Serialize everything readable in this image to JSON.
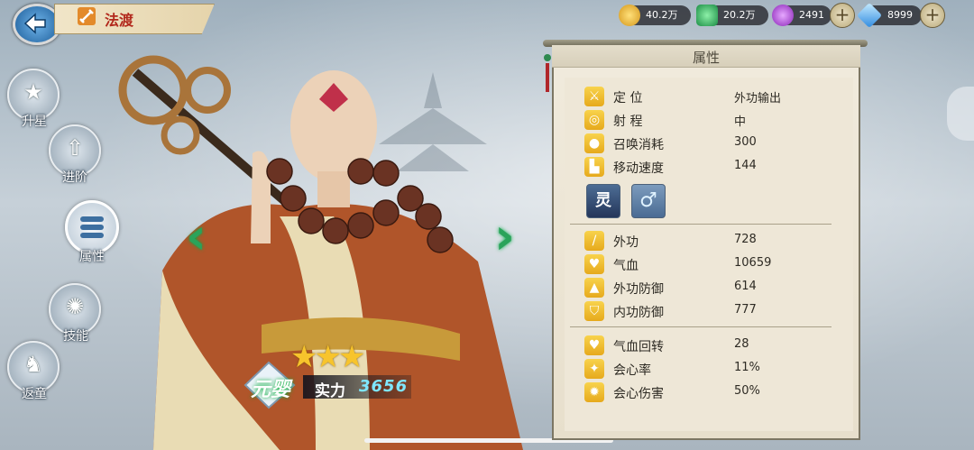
{
  "header": {
    "back_label": "",
    "hero_name": "法渡"
  },
  "resources": [
    {
      "name": "gold",
      "value": "40.2万",
      "icon": "gold-coin-icon",
      "color": "#f1c23a"
    },
    {
      "name": "jade",
      "value": "20.2万",
      "icon": "green-gem-icon",
      "color": "#3fbf6a"
    },
    {
      "name": "spirit",
      "value": "2491",
      "icon": "purple-swirl-icon",
      "color": "#b04ad8"
    },
    {
      "name": "diamond",
      "value": "8999",
      "icon": "diamond-icon",
      "color": "#5fb8ff"
    }
  ],
  "menu": [
    {
      "id": "star-up",
      "label": "升星",
      "icon": "stars-icon"
    },
    {
      "id": "advance",
      "label": "进阶",
      "icon": "arrow-up-icon"
    },
    {
      "id": "attributes",
      "label": "属性",
      "icon": "list-icon",
      "active": true
    },
    {
      "id": "skills",
      "label": "技能",
      "icon": "skill-sun-icon"
    },
    {
      "id": "rebirth",
      "label": "返童",
      "icon": "rocking-horse-icon"
    }
  ],
  "hero": {
    "stars": 3,
    "rank": "元婴",
    "power_label": "实力",
    "power_value": "3656"
  },
  "panel": {
    "title": "属性",
    "basic": [
      {
        "label": "定 位",
        "value": "外功输出",
        "icon": "sword-icon"
      },
      {
        "label": "射 程",
        "value": "中",
        "icon": "target-icon"
      },
      {
        "label": "召唤消耗",
        "value": "300",
        "icon": "drop-icon"
      },
      {
        "label": "移动速度",
        "value": "144",
        "icon": "boot-icon"
      }
    ],
    "tags": [
      {
        "name": "灵",
        "icon": "spirit-class-icon"
      },
      {
        "name": "♂",
        "icon": "male-icon"
      }
    ],
    "combat": [
      {
        "label": "外功",
        "value": "728",
        "icon": "blade-icon"
      },
      {
        "label": "气血",
        "value": "10659",
        "icon": "heart-icon"
      },
      {
        "label": "外功防御",
        "value": "614",
        "icon": "armor-icon"
      },
      {
        "label": "内功防御",
        "value": "777",
        "icon": "shield-icon"
      }
    ],
    "extra": [
      {
        "label": "气血回转",
        "value": "28",
        "icon": "heal-heart-icon"
      },
      {
        "label": "会心率",
        "value": "11%",
        "icon": "crit-icon"
      },
      {
        "label": "会心伤害",
        "value": "50%",
        "icon": "burst-icon"
      }
    ]
  }
}
